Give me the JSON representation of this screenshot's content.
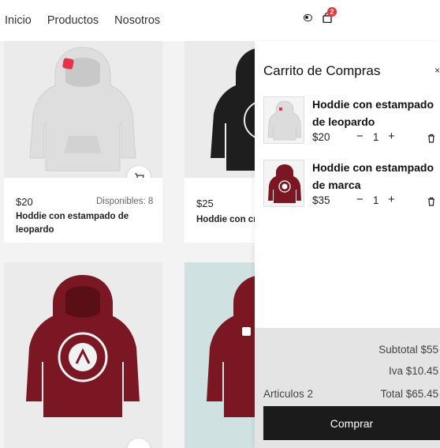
{
  "nav": {
    "links": [
      "Inicio",
      "Productos",
      "Nosotros"
    ],
    "cart_count": "2"
  },
  "products": [
    {
      "price": "$20",
      "stock": "Disponibles: 8",
      "name": "Hoddie con estampado de leopardo",
      "color": "#e5e5e5"
    },
    {
      "price": "$25",
      "name": "Hoddie con cre",
      "color": "#1e1e1e"
    },
    {
      "color": "#7a1722"
    },
    {
      "color": "#7a1722"
    }
  ],
  "cart": {
    "title": "Carrito de Compras",
    "close": "×",
    "items": [
      {
        "name": "Hoddie con estampado de leopardo",
        "price": "$20",
        "minus": "−",
        "qty": "1",
        "plus": "+"
      },
      {
        "name": "Hoddie con estampado de marca",
        "price": "$35",
        "minus": "−",
        "qty": "1",
        "plus": "+"
      }
    ],
    "subtotal": "Subtotal $55",
    "iva": "Iva $10.45",
    "articles": "Articulos 2",
    "total": "Total $65.45",
    "buy_label": "Comprar"
  },
  "icons": {
    "theme": "toggle-icon",
    "cart": "shopping-bag-icon",
    "add": "cart-plus-icon",
    "delete": "trash-icon"
  }
}
